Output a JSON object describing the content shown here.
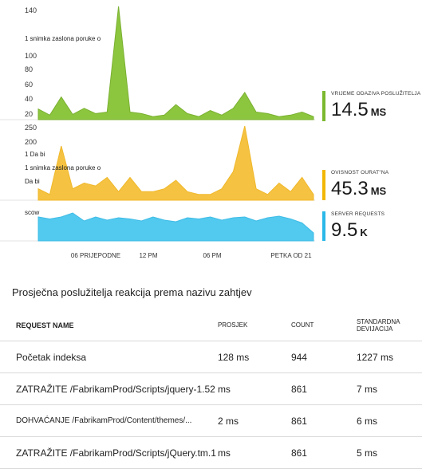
{
  "chart": {
    "ticks_top": [
      "140",
      "100",
      "80",
      "60",
      "40",
      "20"
    ],
    "ticks_mid": [
      "250",
      "200"
    ],
    "x_ticks": [
      "06 PRIJEPODNE",
      "12 PM",
      "06 PM",
      "PETKA OD 21"
    ],
    "annotations": {
      "top": "1 snimka zaslona poruke o",
      "mid_a": "1 Da bi",
      "mid_b": "1 snimka zaslona poruke o",
      "mid_c": "Da bi",
      "bottom": "scow"
    },
    "colors": {
      "green": "#8cc63f",
      "yellow": "#f5c242",
      "blue": "#52c9ef"
    }
  },
  "chart_data": [
    {
      "type": "area",
      "series": [
        {
          "name": "VRIJEME ODAZIVA POSLUŽITELJA",
          "values": [
            14,
            6,
            30,
            7,
            15,
            8,
            10,
            150,
            10,
            8,
            4,
            6,
            20,
            8,
            4,
            12,
            6,
            15,
            36,
            10,
            8,
            4,
            6,
            10,
            4
          ]
        }
      ]
    },
    {
      "type": "area",
      "series": [
        {
          "name": "OVISNOST OURAT\"NA",
          "values": [
            40,
            20,
            190,
            40,
            60,
            50,
            80,
            30,
            80,
            30,
            30,
            40,
            70,
            30,
            20,
            20,
            40,
            100,
            260,
            40,
            20,
            60,
            30,
            80,
            20
          ]
        }
      ]
    },
    {
      "type": "area",
      "series": [
        {
          "name": "SERVER REQUESTS",
          "values": [
            60,
            55,
            60,
            70,
            50,
            60,
            52,
            58,
            55,
            50,
            60,
            52,
            48,
            58,
            55,
            60,
            52,
            58,
            60,
            50,
            58,
            62,
            55,
            45,
            20
          ]
        }
      ]
    }
  ],
  "metrics": [
    {
      "label": "VRIJEME ODAZIVA POSLUŽITELJA",
      "value": "14.5",
      "unit": "MS",
      "color": "#7cb82f"
    },
    {
      "label": "OVISNOST OURAT\"NA",
      "value": "45.3",
      "unit": "MS",
      "color": "#f2b705"
    },
    {
      "label": "SERVER REQUESTS",
      "value": "9.5",
      "unit": "K",
      "color": "#2ab8e8"
    }
  ],
  "table": {
    "title": "Prosječna poslužitelja reakcija prema nazivu zahtjev",
    "headers": [
      "REQUEST NAME",
      "PROSJEK",
      "COUNT",
      "STANDARDNA DEVIJACIJA"
    ],
    "rows": [
      {
        "name": "Početak indeksa",
        "avg": "128 ms",
        "count": "944",
        "std": "1227 ms"
      },
      {
        "name": "ZATRAŽITE /FabrikamProd/Scripts/jquery-1.52",
        "avg": "ms",
        "count": "861",
        "std": "7 ms"
      },
      {
        "name": "DOHVAĆANJE /FabrikamProd/Content/themes/...",
        "avg": "2 ms",
        "count": "861",
        "std": "6 ms"
      },
      {
        "name": "ZATRAŽITE /FabrikamProd/Scripts/jQuery.tm.1",
        "avg": "ms",
        "count": "861",
        "std": "5 ms"
      }
    ]
  }
}
